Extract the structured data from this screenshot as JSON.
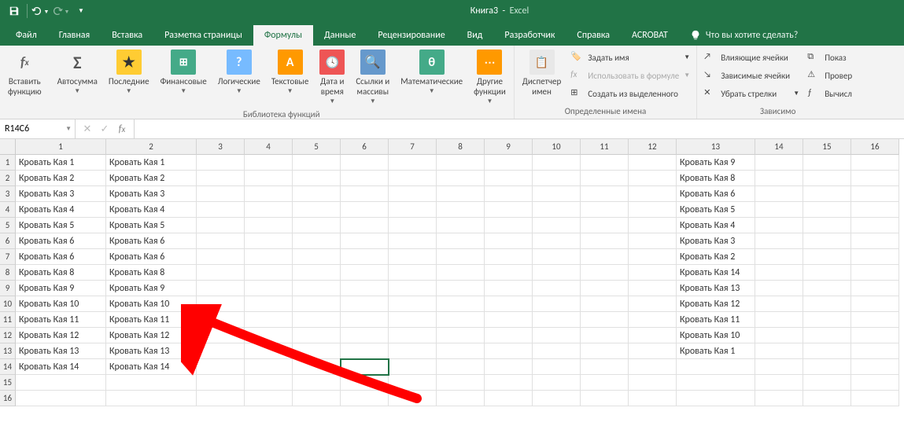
{
  "title": {
    "book": "Книга3",
    "app": "Excel"
  },
  "qat": {
    "save": "save-icon",
    "undo": "undo-icon",
    "redo": "redo-icon"
  },
  "tabs": [
    {
      "id": "file",
      "label": "Файл"
    },
    {
      "id": "home",
      "label": "Главная"
    },
    {
      "id": "insert",
      "label": "Вставка"
    },
    {
      "id": "layout",
      "label": "Разметка страницы"
    },
    {
      "id": "formulas",
      "label": "Формулы",
      "active": true
    },
    {
      "id": "data",
      "label": "Данные"
    },
    {
      "id": "review",
      "label": "Рецензирование"
    },
    {
      "id": "view",
      "label": "Вид"
    },
    {
      "id": "developer",
      "label": "Разработчик"
    },
    {
      "id": "help",
      "label": "Справка"
    },
    {
      "id": "acrobat",
      "label": "ACROBAT"
    }
  ],
  "tellme": "Что вы хотите сделать?",
  "ribbon": {
    "insert_fn": "Вставить\nфункцию",
    "lib": {
      "autosum": "Автосумма",
      "recent": "Последние",
      "financial": "Финансовые",
      "logical": "Логические",
      "text": "Текстовые",
      "datetime": "Дата и\nвремя",
      "lookup": "Ссылки и\nмассивы",
      "math": "Математические",
      "more": "Другие\nфункции",
      "group": "Библиотека функций"
    },
    "names": {
      "manager": "Диспетчер\nимен",
      "define": "Задать имя",
      "use": "Использовать в формуле",
      "create": "Создать из выделенного",
      "group": "Определенные имена"
    },
    "audit": {
      "precedents": "Влияющие ячейки",
      "dependents": "Зависимые ячейки",
      "remove": "Убрать стрелки",
      "show": "Показ",
      "check": "Провер",
      "eval": "Вычисл",
      "group": "Зависимо"
    }
  },
  "namebox": "R14C6",
  "formula": "",
  "columns": [
    {
      "n": 1,
      "w": 115
    },
    {
      "n": 2,
      "w": 115
    },
    {
      "n": 3,
      "w": 61
    },
    {
      "n": 4,
      "w": 61
    },
    {
      "n": 5,
      "w": 61
    },
    {
      "n": 6,
      "w": 61
    },
    {
      "n": 7,
      "w": 61
    },
    {
      "n": 8,
      "w": 61
    },
    {
      "n": 9,
      "w": 61
    },
    {
      "n": 10,
      "w": 61
    },
    {
      "n": 11,
      "w": 61
    },
    {
      "n": 12,
      "w": 61
    },
    {
      "n": 13,
      "w": 100
    },
    {
      "n": 14,
      "w": 61
    },
    {
      "n": 15,
      "w": 61
    },
    {
      "n": 16,
      "w": 61
    }
  ],
  "rows": [
    1,
    2,
    3,
    4,
    5,
    6,
    7,
    8,
    9,
    10,
    11,
    12,
    13,
    14,
    15,
    16
  ],
  "data": {
    "1": {
      "1": "Кровать Кая 1",
      "2": "Кровать Кая 1",
      "13": "Кровать Кая 9"
    },
    "2": {
      "1": "Кровать Кая 2",
      "2": "Кровать Кая 2",
      "13": "Кровать Кая 8"
    },
    "3": {
      "1": "Кровать Кая 3",
      "2": "Кровать Кая 3",
      "13": "Кровать Кая 6"
    },
    "4": {
      "1": "Кровать Кая 4",
      "2": "Кровать Кая 4",
      "13": "Кровать Кая 5"
    },
    "5": {
      "1": "Кровать Кая 5",
      "2": "Кровать Кая 5",
      "13": "Кровать Кая 4"
    },
    "6": {
      "1": "Кровать Кая 6",
      "2": "Кровать Кая 6",
      "13": "Кровать Кая 3"
    },
    "7": {
      "1": "Кровать Кая 6",
      "2": "Кровать Кая 6",
      "13": "Кровать Кая 2"
    },
    "8": {
      "1": "Кровать Кая 8",
      "2": "Кровать Кая 8",
      "13": "Кровать Кая 14"
    },
    "9": {
      "1": "Кровать Кая 9",
      "2": "Кровать Кая 9",
      "13": "Кровать Кая 13"
    },
    "10": {
      "1": "Кровать Кая 10",
      "2": "Кровать Кая 10",
      "13": "Кровать Кая 12"
    },
    "11": {
      "1": "Кровать Кая 11",
      "2": "Кровать Кая 11",
      "13": "Кровать Кая 11"
    },
    "12": {
      "1": "Кровать Кая 12",
      "2": "Кровать Кая 12",
      "13": "Кровать Кая 10"
    },
    "13": {
      "1": "Кровать Кая 13",
      "2": "Кровать Кая 13",
      "13": "Кровать Кая 1"
    },
    "14": {
      "1": "Кровать Кая 14",
      "2": "Кровать Кая 14"
    }
  },
  "selection": {
    "row": 14,
    "col": 6
  }
}
